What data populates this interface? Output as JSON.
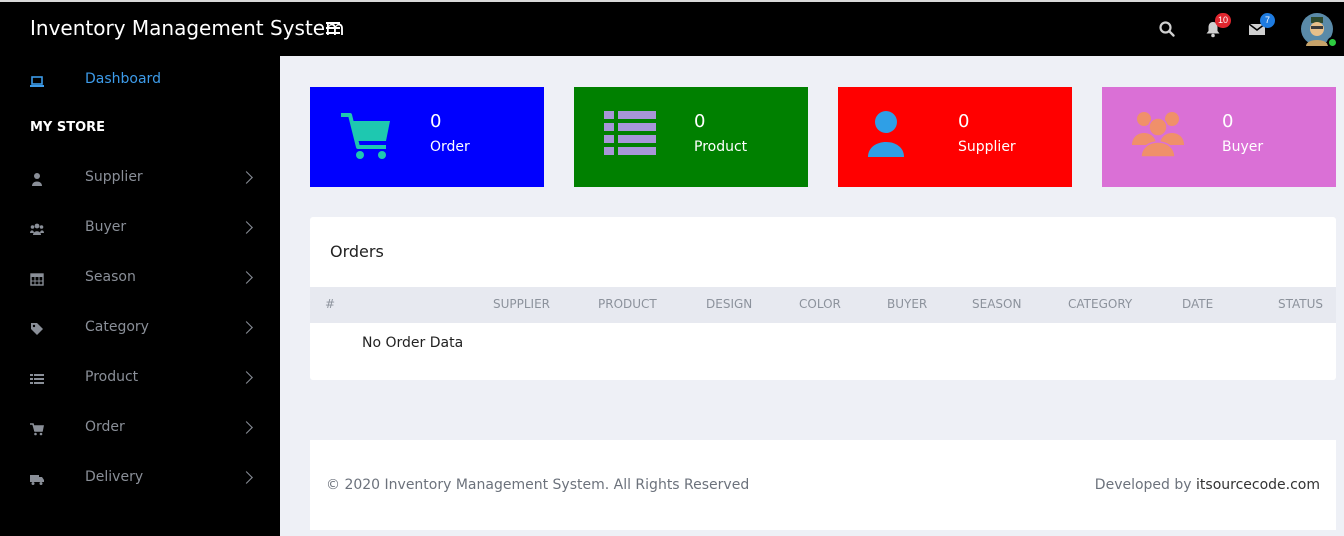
{
  "header": {
    "title": "Inventory Management System",
    "notifications_count": "10",
    "messages_count": "7",
    "colors": {
      "bar": "#000000",
      "notif_badge": "#e0262e",
      "msg_badge": "#1e7be0"
    }
  },
  "sidebar": {
    "dashboard_label": "Dashboard",
    "section_title": "MY STORE",
    "items": [
      {
        "label": "Supplier",
        "icon": "user-icon"
      },
      {
        "label": "Buyer",
        "icon": "users-icon"
      },
      {
        "label": "Season",
        "icon": "calendar-icon"
      },
      {
        "label": "Category",
        "icon": "tags-icon"
      },
      {
        "label": "Product",
        "icon": "list-icon"
      },
      {
        "label": "Order",
        "icon": "cart-icon"
      },
      {
        "label": "Delivery",
        "icon": "truck-icon"
      }
    ]
  },
  "cards": [
    {
      "count": "0",
      "label": "Order",
      "color": "#0000ff",
      "icon": "cart-icon"
    },
    {
      "count": "0",
      "label": "Product",
      "color": "#008000",
      "icon": "list-icon"
    },
    {
      "count": "0",
      "label": "Supplier",
      "color": "#ff0000",
      "icon": "user-icon"
    },
    {
      "count": "0",
      "label": "Buyer",
      "color": "#da70d6",
      "icon": "users-icon"
    }
  ],
  "orders": {
    "title": "Orders",
    "columns": [
      "#",
      "SUPPLIER",
      "PRODUCT",
      "DESIGN",
      "COLOR",
      "BUYER",
      "SEASON",
      "CATEGORY",
      "DATE",
      "STATUS"
    ],
    "empty_text": "No Order Data"
  },
  "footer": {
    "copyright": "© 2020 Inventory Management System. All Rights Reserved",
    "developed_prefix": "Developed by ",
    "developer_link": "itsourcecode.com"
  }
}
